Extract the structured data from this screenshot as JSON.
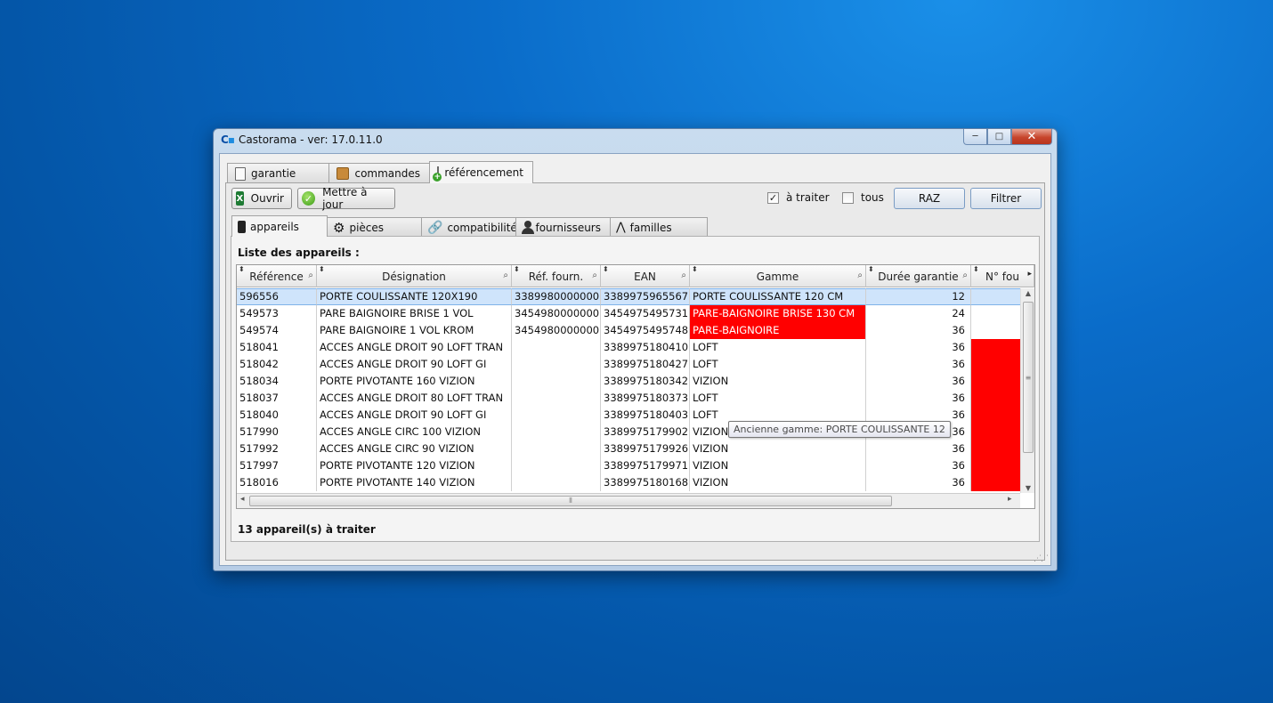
{
  "window": {
    "logo_text": "C",
    "title": "Castorama - ver: 17.0.11.0",
    "controls": {
      "minimize": "─",
      "maximize": "□",
      "close": "✕"
    }
  },
  "top_tabs": [
    {
      "label": "garantie",
      "icon": "clipboard-icon"
    },
    {
      "label": "commandes",
      "icon": "box-icon"
    },
    {
      "label": "référencement",
      "icon": "add-list-icon",
      "active": true
    }
  ],
  "toolbar": {
    "open_label": "Ouvrir",
    "update_label": "Mettre à jour",
    "a_traiter_label": "à traiter",
    "a_traiter_checked": true,
    "tous_label": "tous",
    "tous_checked": false,
    "raz_label": "RAZ",
    "filtrer_label": "Filtrer"
  },
  "sub_tabs": [
    {
      "label": "appareils",
      "icon": "phone-icon",
      "active": true
    },
    {
      "label": "pièces",
      "icon": "gear-icon"
    },
    {
      "label": "compatibilité",
      "icon": "link-icon"
    },
    {
      "label": "fournisseurs",
      "icon": "person-icon"
    },
    {
      "label": "familles",
      "icon": "tree-icon"
    }
  ],
  "list": {
    "title": "Liste des appareils :",
    "columns": [
      "Référence",
      "Désignation",
      "Réf. fourn.",
      "EAN",
      "Gamme",
      "Durée garantie",
      "N° fou"
    ],
    "rows": [
      [
        "596556",
        "PORTE COULISSANTE 120X190",
        "3389980000000",
        "3389975965567",
        "PORTE COULISSANTE 120 CM",
        "12",
        ""
      ],
      [
        "549573",
        "PARE BAIGNOIRE BRISE 1 VOL",
        "3454980000000",
        "3454975495731",
        "PARE-BAIGNOIRE BRISE 130 CM",
        "24",
        ""
      ],
      [
        "549574",
        "PARE BAIGNOIRE 1 VOL KROM",
        "3454980000000",
        "3454975495748",
        "PARE-BAIGNOIRE",
        "36",
        ""
      ],
      [
        "518041",
        "ACCES ANGLE DROIT 90 LOFT TRAN",
        "",
        "3389975180410",
        "LOFT",
        "36",
        ""
      ],
      [
        "518042",
        "ACCES ANGLE DROIT 90 LOFT GI",
        "",
        "3389975180427",
        "LOFT",
        "36",
        ""
      ],
      [
        "518034",
        "PORTE PIVOTANTE 160 VIZION",
        "",
        "3389975180342",
        "VIZION",
        "36",
        ""
      ],
      [
        "518037",
        "ACCES ANGLE DROIT 80 LOFT TRAN",
        "",
        "3389975180373",
        "LOFT",
        "36",
        ""
      ],
      [
        "518040",
        "ACCES ANGLE DROIT 90 LOFT GI",
        "",
        "3389975180403",
        "LOFT",
        "36",
        ""
      ],
      [
        "517990",
        "ACCES ANGLE CIRC 100 VIZION",
        "",
        "3389975179902",
        "VIZION",
        "36",
        ""
      ],
      [
        "517992",
        "ACCES ANGLE CIRC 90 VIZION",
        "",
        "3389975179926",
        "VIZION",
        "36",
        ""
      ],
      [
        "517997",
        "PORTE PIVOTANTE 120 VIZION",
        "",
        "3389975179971",
        "VIZION",
        "36",
        ""
      ],
      [
        "518016",
        "PORTE PIVOTANTE 140 VIZION",
        "",
        "3389975180168",
        "VIZION",
        "36",
        ""
      ]
    ],
    "tooltip": "Ancienne gamme: PORTE COULISSANTE 12",
    "footer": "13 appareil(s) à traiter"
  },
  "colors": {
    "highlight_red": "#ff0000",
    "selected_row": "#cfe4fb",
    "desktop_blue": "#0a6cc9"
  }
}
